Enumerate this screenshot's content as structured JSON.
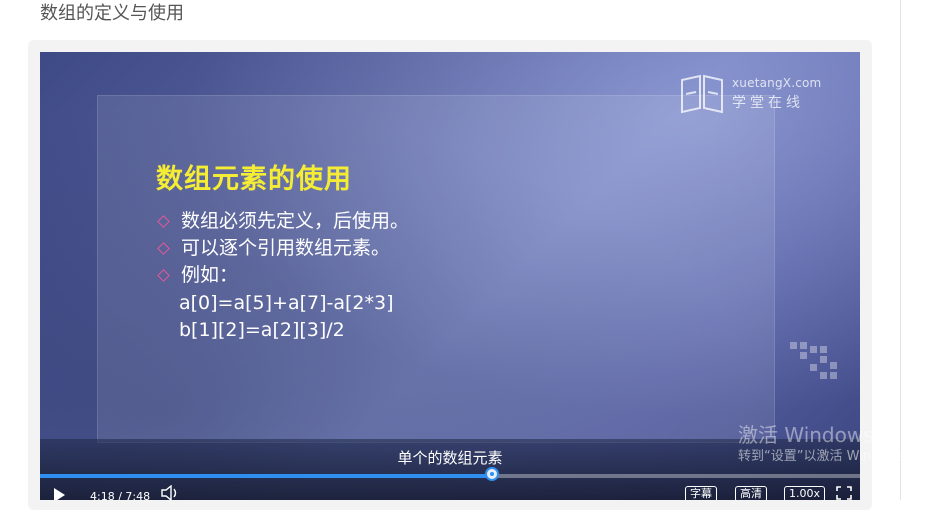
{
  "page": {
    "title": "数组的定义与使用"
  },
  "logo": {
    "en": "xuetangX.com",
    "cn": "学堂在线"
  },
  "slide": {
    "heading": "数组元素的使用",
    "bullets": [
      "数组必须先定义，后使用。",
      "可以逐个引用数组元素。",
      "例如："
    ],
    "code": [
      "a[0]=a[5]+a[7]-a[2*3]",
      "b[1][2]=a[2][3]/2"
    ]
  },
  "player": {
    "subtitle": "单个的数组元素",
    "time": "4:18 / 7:48",
    "progress_fraction": 0.551,
    "buttons": {
      "captions": "字幕",
      "quality": "高清",
      "speed": "1.00x"
    }
  },
  "watermark": {
    "title": "激活 Windows",
    "subtitle": "转到“设置”以激活 Windows。"
  },
  "colors": {
    "heading": "#f5ec34",
    "bullet": "#e4579b",
    "progress": "#2f8ff0"
  }
}
